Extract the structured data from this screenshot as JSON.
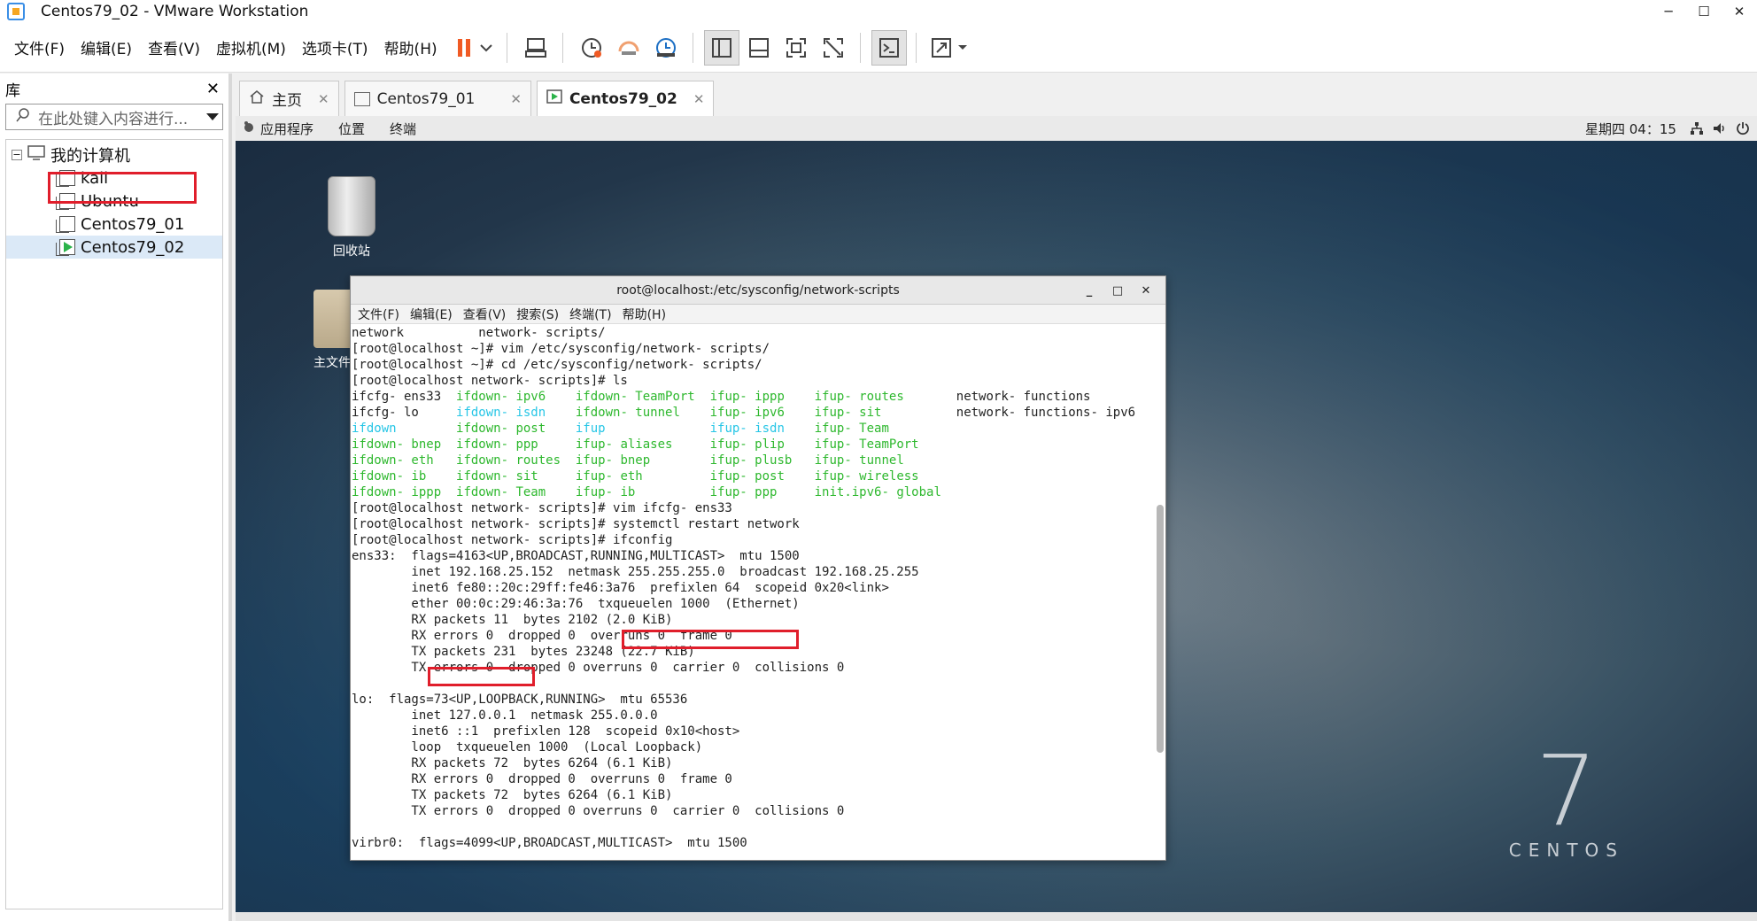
{
  "window": {
    "title": "Centos79_02 - VMware Workstation"
  },
  "menu": [
    "文件(F)",
    "编辑(E)",
    "查看(V)",
    "虚拟机(M)",
    "选项卡(T)",
    "帮助(H)"
  ],
  "library": {
    "title": "库",
    "search_placeholder": "在此处键入内容进行...",
    "root": "我的计算机",
    "vms": [
      "kali",
      "Ubuntu",
      "Centos79_01",
      "Centos79_02"
    ]
  },
  "tabs": [
    {
      "label": "主页"
    },
    {
      "label": "Centos79_01"
    },
    {
      "label": "Centos79_02"
    }
  ],
  "gnome": {
    "apps": "应用程序",
    "places": "位置",
    "terminal": "终端",
    "clock": "星期四 04：15"
  },
  "desktop": {
    "trash_label": "回收站",
    "home_label": "主文件夹",
    "brand_number": "7",
    "brand_word": "CENTOS"
  },
  "terminal": {
    "title": "root@localhost:/etc/sysconfig/network-scripts",
    "menu": [
      "文件(F)",
      "编辑(E)",
      "查看(V)",
      "搜索(S)",
      "终端(T)",
      "帮助(H)"
    ],
    "lines": [
      [
        {
          "t": "network          network- scripts/"
        }
      ],
      [
        {
          "t": "[root@localhost ~]# vim /etc/sysconfig/network- scripts/"
        }
      ],
      [
        {
          "t": "[root@localhost ~]# cd /etc/sysconfig/network- scripts/"
        }
      ],
      [
        {
          "t": "[root@localhost network- scripts]# ls"
        }
      ],
      [
        {
          "t": "ifcfg- ens33  "
        },
        {
          "t": "ifdown- ipv6    ",
          "c": "g"
        },
        {
          "t": "ifdown- TeamPort  ",
          "c": "g"
        },
        {
          "t": "ifup- ippp    ",
          "c": "g"
        },
        {
          "t": "ifup- routes       ",
          "c": "g"
        },
        {
          "t": "network- functions"
        }
      ],
      [
        {
          "t": "ifcfg- lo     "
        },
        {
          "t": "ifdown- isdn    ",
          "c": "c"
        },
        {
          "t": "ifdown- tunnel    ",
          "c": "g"
        },
        {
          "t": "ifup- ipv6    ",
          "c": "g"
        },
        {
          "t": "ifup- sit          ",
          "c": "g"
        },
        {
          "t": "network- functions- ipv6"
        }
      ],
      [
        {
          "t": "ifdown        ",
          "c": "c"
        },
        {
          "t": "ifdown- post    ",
          "c": "g"
        },
        {
          "t": "ifup              ",
          "c": "c"
        },
        {
          "t": "ifup- isdn    ",
          "c": "c"
        },
        {
          "t": "ifup- Team",
          "c": "g"
        }
      ],
      [
        {
          "t": "ifdown- bnep  ",
          "c": "g"
        },
        {
          "t": "ifdown- ppp     ",
          "c": "g"
        },
        {
          "t": "ifup- aliases     ",
          "c": "g"
        },
        {
          "t": "ifup- plip    ",
          "c": "g"
        },
        {
          "t": "ifup- TeamPort",
          "c": "g"
        }
      ],
      [
        {
          "t": "ifdown- eth   ",
          "c": "g"
        },
        {
          "t": "ifdown- routes  ",
          "c": "g"
        },
        {
          "t": "ifup- bnep        ",
          "c": "g"
        },
        {
          "t": "ifup- plusb   ",
          "c": "g"
        },
        {
          "t": "ifup- tunnel",
          "c": "g"
        }
      ],
      [
        {
          "t": "ifdown- ib    ",
          "c": "g"
        },
        {
          "t": "ifdown- sit     ",
          "c": "g"
        },
        {
          "t": "ifup- eth         ",
          "c": "g"
        },
        {
          "t": "ifup- post    ",
          "c": "g"
        },
        {
          "t": "ifup- wireless",
          "c": "g"
        }
      ],
      [
        {
          "t": "ifdown- ippp  ",
          "c": "g"
        },
        {
          "t": "ifdown- Team    ",
          "c": "g"
        },
        {
          "t": "ifup- ib          ",
          "c": "g"
        },
        {
          "t": "ifup- ppp     ",
          "c": "g"
        },
        {
          "t": "init.ipv6- global",
          "c": "g"
        }
      ],
      [
        {
          "t": "[root@localhost network- scripts]# vim ifcfg- ens33"
        }
      ],
      [
        {
          "t": "[root@localhost network- scripts]# systemctl restart network"
        }
      ],
      [
        {
          "t": "[root@localhost network- scripts]# ifconfig"
        }
      ],
      [
        {
          "t": "ens33:  flags=4163<UP,BROADCAST,RUNNING,MULTICAST>  mtu 1500"
        }
      ],
      [
        {
          "t": "        inet 192.168.25.152  netmask 255.255.255.0  broadcast 192.168.25.255"
        }
      ],
      [
        {
          "t": "        inet6 fe80::20c:29ff:fe46:3a76  prefixlen 64  scopeid 0x20<link>"
        }
      ],
      [
        {
          "t": "        ether 00:0c:29:46:3a:76  txqueuelen 1000  (Ethernet)"
        }
      ],
      [
        {
          "t": "        RX packets 11  bytes 2102 (2.0 KiB)"
        }
      ],
      [
        {
          "t": "        RX errors 0  dropped 0  overruns 0  frame 0"
        }
      ],
      [
        {
          "t": "        TX packets 231  bytes 23248 (22.7 KiB)"
        }
      ],
      [
        {
          "t": "        TX errors 0  dropped 0 overruns 0  carrier 0  collisions 0"
        }
      ],
      [
        {
          "t": ""
        }
      ],
      [
        {
          "t": "lo:  flags=73<UP,LOOPBACK,RUNNING>  mtu 65536"
        }
      ],
      [
        {
          "t": "        inet 127.0.0.1  netmask 255.0.0.0"
        }
      ],
      [
        {
          "t": "        inet6 ::1  prefixlen 128  scopeid 0x10<host>"
        }
      ],
      [
        {
          "t": "        loop  txqueuelen 1000  (Local Loopback)"
        }
      ],
      [
        {
          "t": "        RX packets 72  bytes 6264 (6.1 KiB)"
        }
      ],
      [
        {
          "t": "        RX errors 0  dropped 0  overruns 0  frame 0"
        }
      ],
      [
        {
          "t": "        TX packets 72  bytes 6264 (6.1 KiB)"
        }
      ],
      [
        {
          "t": "        TX errors 0  dropped 0 overruns 0  carrier 0  collisions 0"
        }
      ],
      [
        {
          "t": ""
        }
      ],
      [
        {
          "t": "virbr0:  flags=4099<UP,BROADCAST,MULTICAST>  mtu 1500"
        }
      ]
    ]
  },
  "colors": {
    "highlight": "#e01e2b",
    "ls_executable": "#2eb82e",
    "ls_symlink": "#27c6e6"
  }
}
